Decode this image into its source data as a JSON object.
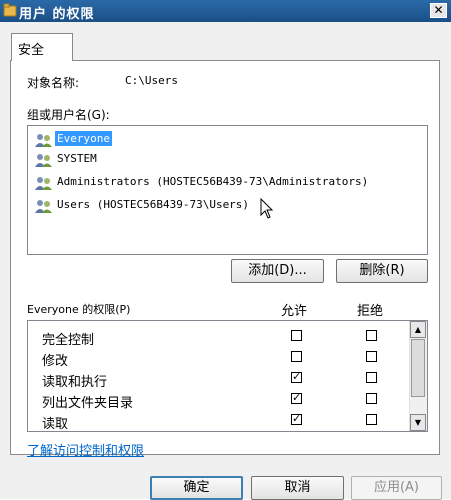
{
  "window": {
    "title": "用户 的权限",
    "close_glyph": "✕"
  },
  "tabs": [
    {
      "label": "安全"
    }
  ],
  "object": {
    "label": "对象名称:",
    "value": "C:\\Users"
  },
  "groups": {
    "label": "组或用户名(G):",
    "items": [
      {
        "name": "Everyone",
        "selected": true
      },
      {
        "name": "SYSTEM",
        "selected": false
      },
      {
        "name": "Administrators (HOSTEC56B439-73\\Administrators)",
        "selected": false
      },
      {
        "name": "Users (HOSTEC56B439-73\\Users)",
        "selected": false
      }
    ]
  },
  "buttons": {
    "add": "添加(D)...",
    "remove": "删除(R)",
    "ok": "确定",
    "cancel": "取消",
    "apply": "应用(A)"
  },
  "permissions": {
    "header": "Everyone 的权限(P)",
    "allow_label": "允许",
    "deny_label": "拒绝",
    "rows": [
      {
        "name": "完全控制",
        "allow": false,
        "deny": false
      },
      {
        "name": "修改",
        "allow": false,
        "deny": false
      },
      {
        "name": "读取和执行",
        "allow": true,
        "deny": false
      },
      {
        "name": "列出文件夹目录",
        "allow": true,
        "deny": false
      },
      {
        "name": "读取",
        "allow": true,
        "deny": false
      }
    ]
  },
  "help_link": "了解访问控制和权限",
  "icons": {
    "title": "folder-icon",
    "users": "users-icon",
    "scroll_up": "scroll-up-icon",
    "scroll_down": "scroll-down-icon"
  },
  "colors": {
    "title_bar": "#1f5a96",
    "selection": "#3399ff",
    "link": "#0066cc"
  }
}
